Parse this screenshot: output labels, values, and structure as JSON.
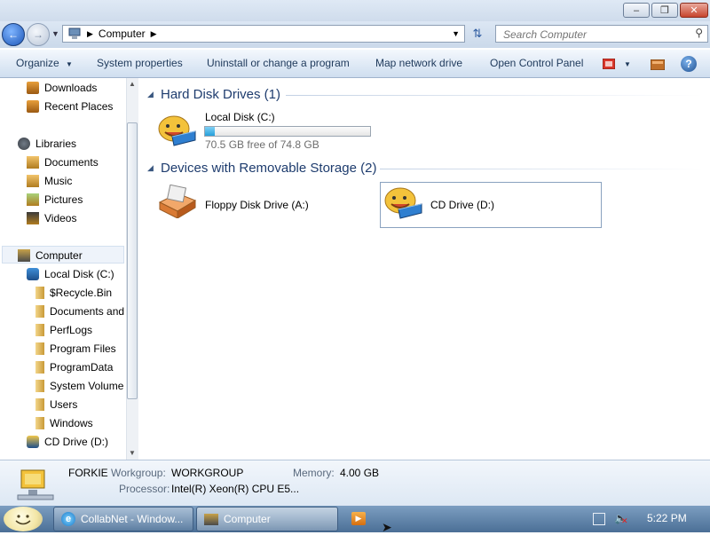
{
  "window": {
    "minimize_glyph": "–",
    "maximize_glyph": "❐",
    "close_glyph": "✕"
  },
  "address": {
    "location": "Computer",
    "search_placeholder": "Search Computer"
  },
  "toolbar": {
    "organize": "Organize",
    "system_properties": "System properties",
    "uninstall": "Uninstall or change a program",
    "map_network_drive": "Map network drive",
    "open_control_panel": "Open Control Panel"
  },
  "nav": {
    "favorites": [
      {
        "label": "Downloads",
        "icon": "downloads-icon"
      },
      {
        "label": "Recent Places",
        "icon": "recent-places-icon"
      }
    ],
    "libraries": {
      "label": "Libraries",
      "items": [
        {
          "label": "Documents",
          "icon": "documents-icon"
        },
        {
          "label": "Music",
          "icon": "music-icon"
        },
        {
          "label": "Pictures",
          "icon": "pictures-icon"
        },
        {
          "label": "Videos",
          "icon": "videos-icon"
        }
      ]
    },
    "computer": {
      "label": "Computer",
      "local_disk": "Local Disk (C:)",
      "folders": [
        {
          "label": "$Recycle.Bin",
          "locked": true
        },
        {
          "label": "Documents and",
          "locked": true
        },
        {
          "label": "PerfLogs",
          "locked": false
        },
        {
          "label": "Program Files",
          "locked": false
        },
        {
          "label": "ProgramData",
          "locked": false
        },
        {
          "label": "System Volume",
          "locked": true
        },
        {
          "label": "Users",
          "locked": false
        },
        {
          "label": "Windows",
          "locked": false
        }
      ],
      "cd_drive": "CD Drive (D:)"
    }
  },
  "content": {
    "hard_disk_header": "Hard Disk Drives (1)",
    "local_disk": {
      "name": "Local Disk (C:)",
      "free_text": "70.5 GB free of 74.8 GB",
      "used_fraction": 0.057,
      "bar_color": "#26a0da"
    },
    "removable_header": "Devices with Removable Storage (2)",
    "floppy": {
      "name": "Floppy Disk Drive (A:)"
    },
    "cd": {
      "name": "CD Drive (D:)"
    }
  },
  "details": {
    "computer_name": "FORKIE",
    "workgroup_label": "Workgroup:",
    "workgroup_value": "WORKGROUP",
    "memory_label": "Memory:",
    "memory_value": "4.00 GB",
    "processor_label": "Processor:",
    "processor_value": "Intel(R) Xeon(R) CPU E5..."
  },
  "taskbar": {
    "items": [
      {
        "label": "CollabNet - Window..."
      },
      {
        "label": "Computer"
      }
    ],
    "clock": "5:22 PM"
  }
}
